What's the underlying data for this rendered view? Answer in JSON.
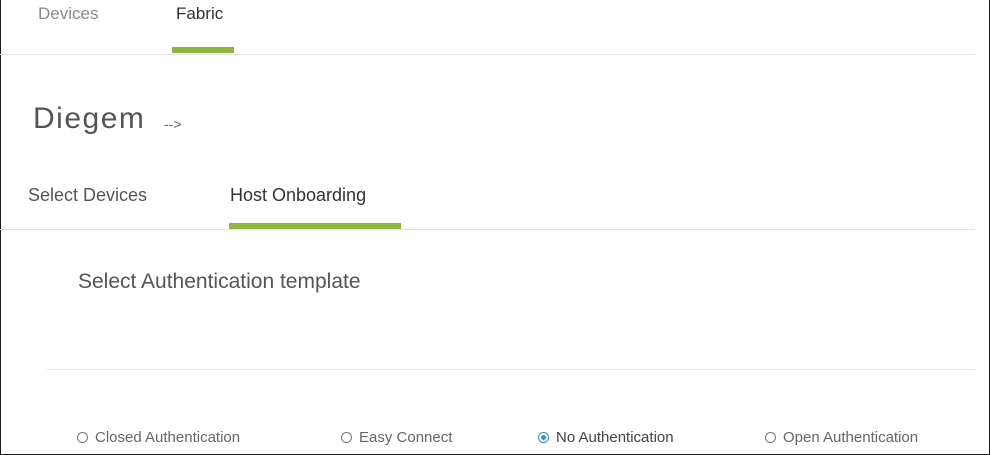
{
  "top_tabs": [
    {
      "label": "Devices",
      "active": false
    },
    {
      "label": "Fabric",
      "active": true
    }
  ],
  "site": {
    "name": "Diegem",
    "arrow": "-->"
  },
  "sub_tabs": [
    {
      "label": "Select Devices",
      "active": false
    },
    {
      "label": "Host Onboarding",
      "active": true
    }
  ],
  "auth_section": {
    "heading": "Select Authentication template",
    "options": [
      {
        "label": "Closed Authentication",
        "selected": false
      },
      {
        "label": "Easy Connect",
        "selected": false
      },
      {
        "label": "No Authentication",
        "selected": true
      },
      {
        "label": "Open Authentication",
        "selected": false
      }
    ]
  },
  "colors": {
    "accent_underline": "#8db53f",
    "radio_selected": "#2f8fd0",
    "divider": "#e2e2e2"
  }
}
